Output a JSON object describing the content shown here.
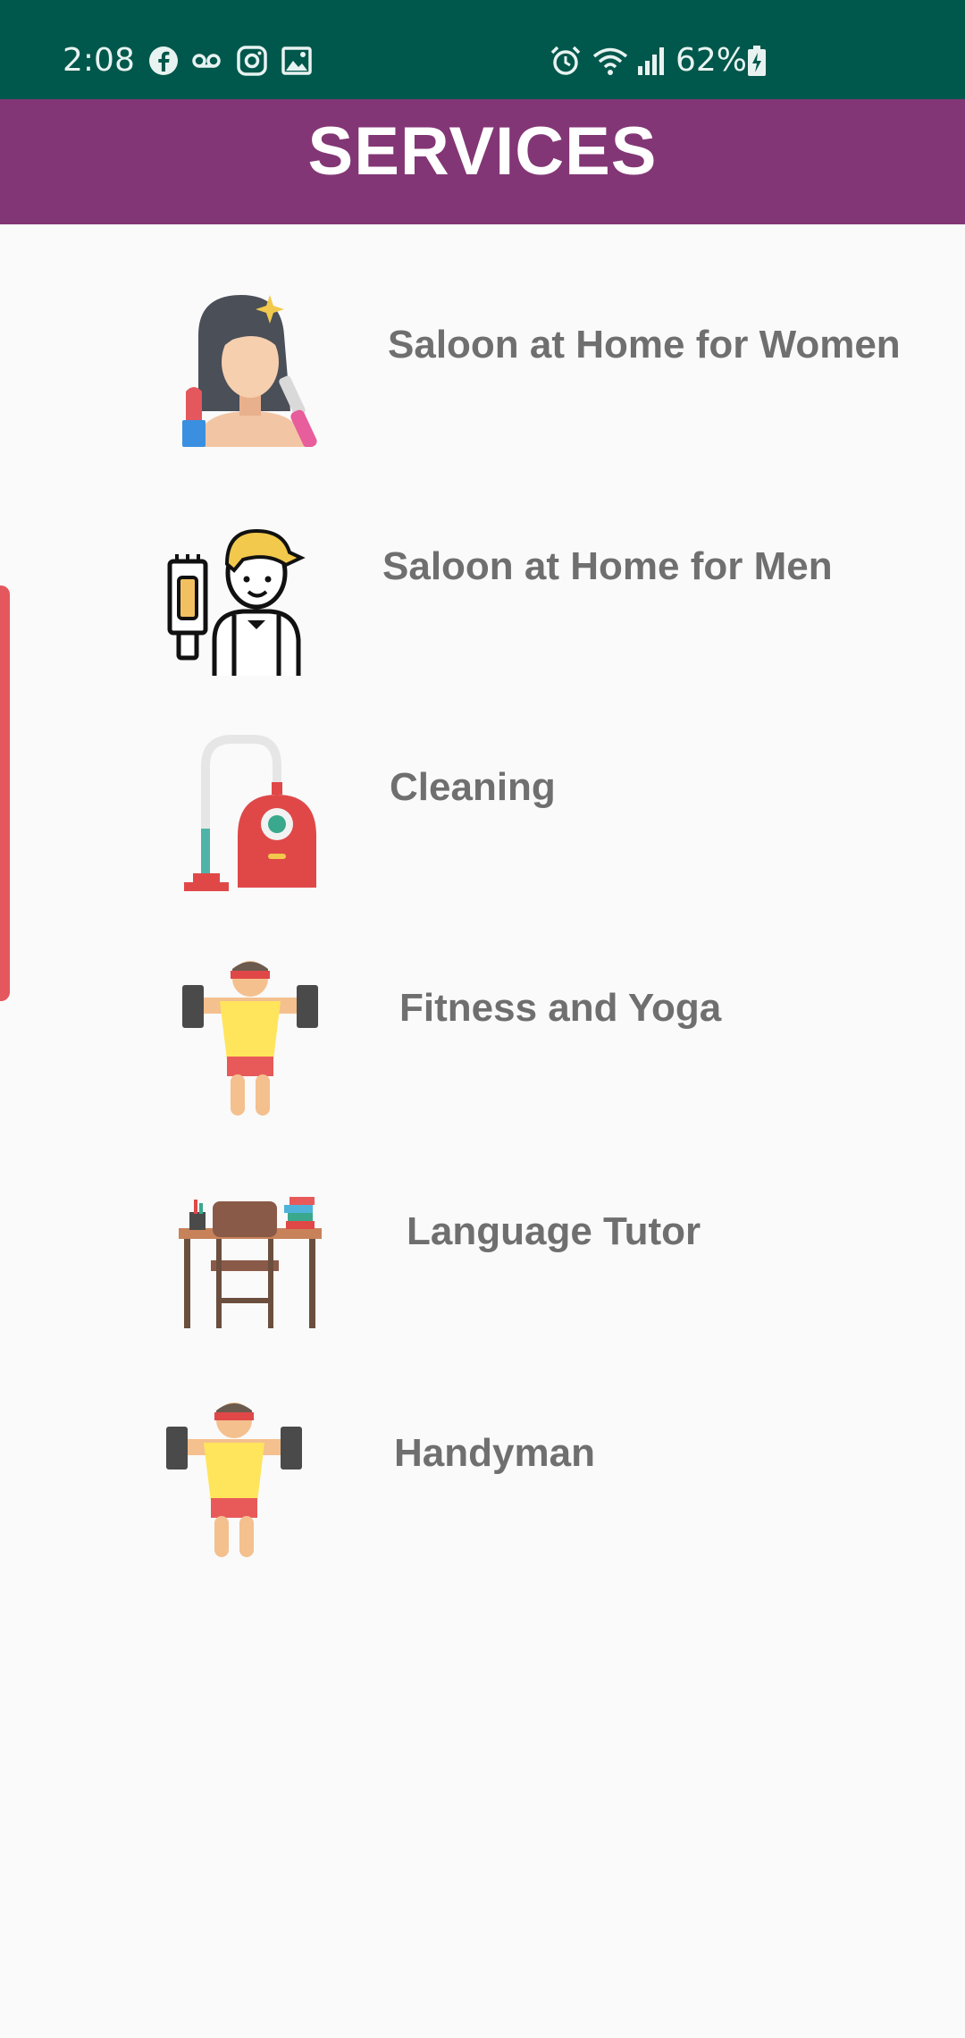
{
  "status_bar": {
    "time": "2:08",
    "battery": "62%",
    "icons": [
      "facebook-icon",
      "voicemail-icon",
      "instagram-icon",
      "gallery-icon",
      "alarm-icon",
      "wifi-icon",
      "signal-icon",
      "battery-charging-icon"
    ]
  },
  "header": {
    "title": "SERVICES"
  },
  "colors": {
    "status_bar": "#00574b",
    "app_bar": "#833675",
    "label_text": "#6f6f6f",
    "edge_handle": "#e4575c"
  },
  "services": [
    {
      "label": "Saloon at Home for Women",
      "icon": "woman-makeup-icon"
    },
    {
      "label": "Saloon at Home for Men",
      "icon": "barber-man-icon"
    },
    {
      "label": "Cleaning",
      "icon": "vacuum-cleaner-icon"
    },
    {
      "label": "Fitness and Yoga",
      "icon": "fitness-dumbbell-icon"
    },
    {
      "label": "Language Tutor",
      "icon": "study-desk-icon"
    },
    {
      "label": "Handyman",
      "icon": "fitness-dumbbell-icon"
    }
  ]
}
